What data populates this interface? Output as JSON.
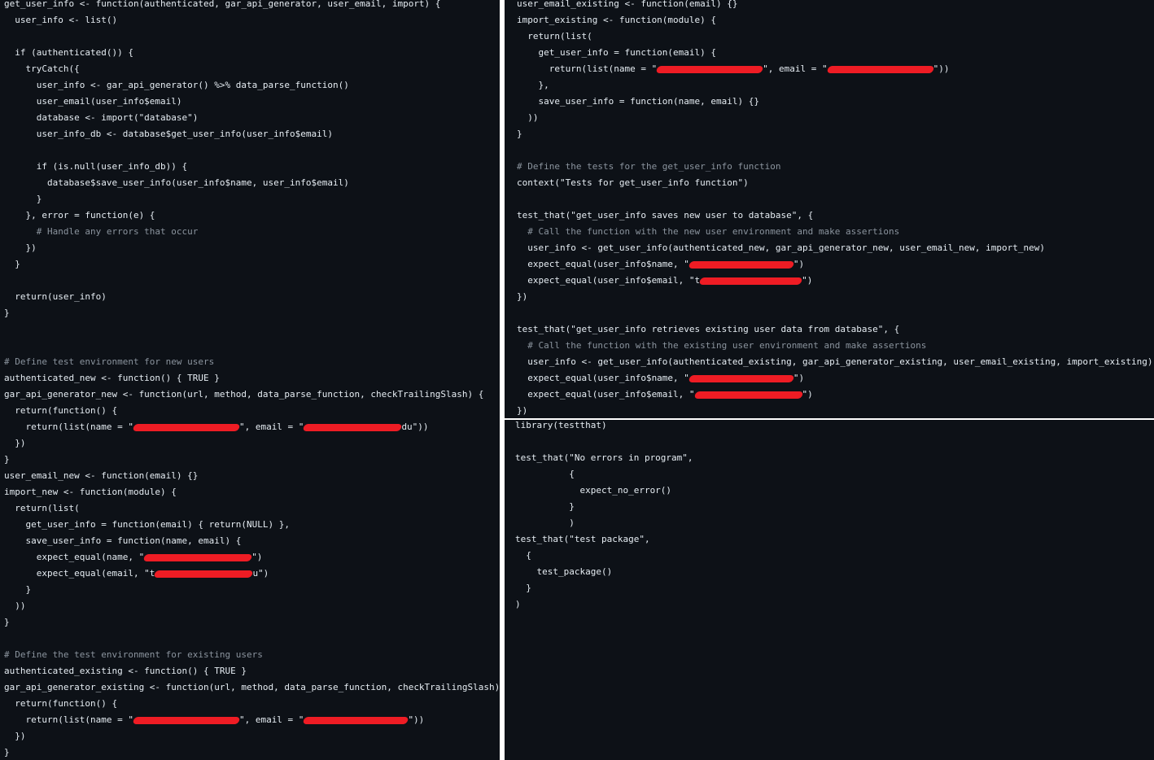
{
  "panels": {
    "left": {
      "lines": [
        "get_user_info <- function(authenticated, gar_api_generator, user_email, import) {",
        "  user_info <- list()",
        "",
        "  if (authenticated()) {",
        "    tryCatch({",
        "      user_info <- gar_api_generator() %>% data_parse_function()",
        "      user_email(user_info$email)",
        "      database <- import(\"database\")",
        "      user_info_db <- database$get_user_info(user_info$email)",
        "",
        "      if (is.null(user_info_db)) {",
        "        database$save_user_info(user_info$name, user_info$email)",
        "      }",
        "    }, error = function(e) {",
        "      # Handle any errors that occur",
        "    })",
        "  }",
        "",
        "  return(user_info)",
        "}",
        "",
        "",
        "# Define test environment for new users",
        "authenticated_new <- function() { TRUE }",
        "gar_api_generator_new <- function(url, method, data_parse_function, checkTrailingSlash) {",
        "  return(function() {",
        "    return(list(name = \"",
        "  })",
        "}",
        "user_email_new <- function(email) {}",
        "import_new <- function(module) {",
        "  return(list(",
        "    get_user_info = function(email) { return(NULL) },",
        "    save_user_info = function(name, email) {",
        "      expect_equal(name, \"",
        "      expect_equal(email, \"t",
        "    }",
        "  ))",
        "}",
        "",
        "# Define the test environment for existing users",
        "authenticated_existing <- function() { TRUE }",
        "gar_api_generator_existing <- function(url, method, data_parse_function, checkTrailingSlash) {",
        "  return(function() {",
        "    return(list(name = \"",
        "  })",
        "}"
      ]
    },
    "top_right": {
      "lines": [
        "user_email_existing <- function(email) {}",
        "import_existing <- function(module) {",
        "  return(list(",
        "    get_user_info = function(email) {",
        "      return(list(name = \"",
        "    },",
        "    save_user_info = function(name, email) {}",
        "  ))",
        "}",
        "",
        "# Define the tests for the get_user_info function",
        "context(\"Tests for get_user_info function\")",
        "",
        "test_that(\"get_user_info saves new user to database\", {",
        "  # Call the function with the new user environment and make assertions",
        "  user_info <- get_user_info(authenticated_new, gar_api_generator_new, user_email_new, import_new)",
        "  expect_equal(user_info$name, \"",
        "  expect_equal(user_info$email, \"t",
        "})",
        "",
        "test_that(\"get_user_info retrieves existing user data from database\", {",
        "  # Call the function with the existing user environment and make assertions",
        "  user_info <- get_user_info(authenticated_existing, gar_api_generator_existing, user_email_existing, import_existing)",
        "  expect_equal(user_info$name, \"",
        "  expect_equal(user_info$email, \"",
        "})"
      ]
    },
    "bottom_right": {
      "lines": [
        "library(testthat)",
        "",
        "test_that(\"No errors in program\",",
        "          {",
        "            expect_no_error()",
        "          }",
        "          )",
        "test_that(\"test package\",",
        "  {",
        "    test_package()",
        "  }",
        ")"
      ]
    }
  },
  "fragments": {
    "email_mid": "\", email = \"",
    "close_call": "\"))",
    "du_close": "du\"))",
    "close_paren": "\")",
    "u_close": "u\")",
    "close_quote_paren": "\")",
    "comma_email": "\", email = \""
  },
  "colors": {
    "background": "#0d1117",
    "text": "#e6edf3",
    "keyword": "#ff7b72",
    "string": "#a5d6ff",
    "comment": "#8b949e",
    "redaction": "#ee1c24"
  }
}
